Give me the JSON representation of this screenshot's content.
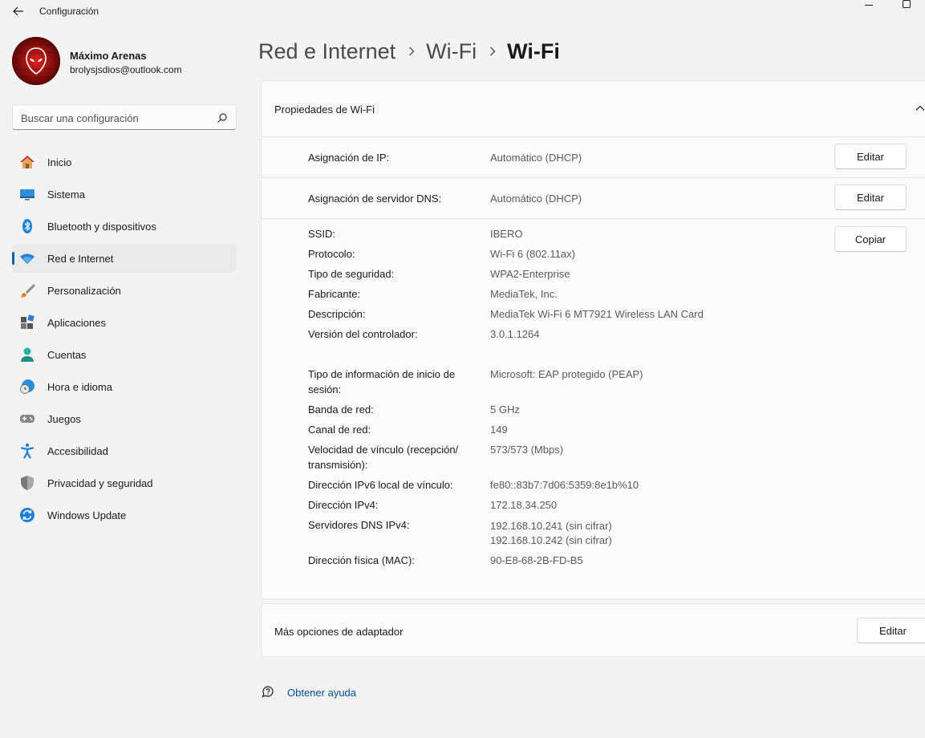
{
  "window": {
    "title": "Configuración"
  },
  "user": {
    "name": "Máximo Arenas",
    "email": "brolysjsdios@outlook.com"
  },
  "search": {
    "placeholder": "Buscar una configuración"
  },
  "sidebar": {
    "items": [
      {
        "label": "Inicio",
        "icon": "home-icon"
      },
      {
        "label": "Sistema",
        "icon": "system-icon"
      },
      {
        "label": "Bluetooth y dispositivos",
        "icon": "bluetooth-icon"
      },
      {
        "label": "Red e Internet",
        "icon": "wifi-icon",
        "selected": true
      },
      {
        "label": "Personalización",
        "icon": "brush-icon"
      },
      {
        "label": "Aplicaciones",
        "icon": "apps-icon"
      },
      {
        "label": "Cuentas",
        "icon": "accounts-icon"
      },
      {
        "label": "Hora e idioma",
        "icon": "time-language-icon"
      },
      {
        "label": "Juegos",
        "icon": "gamepad-icon"
      },
      {
        "label": "Accesibilidad",
        "icon": "accessibility-icon"
      },
      {
        "label": "Privacidad y seguridad",
        "icon": "shield-icon"
      },
      {
        "label": "Windows Update",
        "icon": "update-icon"
      }
    ]
  },
  "breadcrumb": [
    "Red e Internet",
    "Wi-Fi",
    "Wi-Fi"
  ],
  "properties": {
    "header": "Propiedades de Wi-Fi",
    "ip_assignment": {
      "label": "Asignación de IP:",
      "value": "Automático (DHCP)",
      "button": "Editar"
    },
    "dns_assignment": {
      "label": "Asignación de servidor DNS:",
      "value": "Automático (DHCP)",
      "button": "Editar"
    },
    "copy_button": "Copiar",
    "details": [
      {
        "label": "SSID:",
        "value": "IBERO"
      },
      {
        "label": "Protocolo:",
        "value": "Wi-Fi 6 (802.11ax)"
      },
      {
        "label": "Tipo de seguridad:",
        "value": "WPA2-Enterprise"
      },
      {
        "label": "Fabricante:",
        "value": "MediaTek, Inc."
      },
      {
        "label": "Descripción:",
        "value": "MediaTek Wi-Fi 6 MT7921 Wireless LAN Card"
      },
      {
        "label": "Versión del controlador:",
        "value": "3.0.1.1264"
      },
      {
        "label_line1": "Tipo de información de inicio de",
        "label_line2": "sesión:",
        "value": "Microsoft: EAP protegido (PEAP)"
      },
      {
        "label": "Banda de red:",
        "value": "5 GHz"
      },
      {
        "label": "Canal de red:",
        "value": "149"
      },
      {
        "label_line1": "Velocidad de vínculo (recepción/",
        "label_line2": "transmisión):",
        "value": "573/573 (Mbps)"
      },
      {
        "label": "Dirección IPv6 local de vínculo:",
        "value": "fe80::83b7:7d06:5359:8e1b%10"
      },
      {
        "label": "Dirección IPv4:",
        "value": "172.18.34.250"
      },
      {
        "label": "Servidores DNS IPv4:",
        "value_line1": "192.168.10.241 (sin cifrar)",
        "value_line2": "192.168.10.242 (sin cifrar)"
      },
      {
        "label": "Dirección física (MAC):",
        "value": "90-E8-68-2B-FD-B5"
      }
    ]
  },
  "adapter": {
    "label": "Más opciones de adaptador",
    "button": "Editar"
  },
  "help": {
    "link": "Obtener ayuda"
  },
  "colors": {
    "accent": "#005fb8",
    "link": "#004f9f",
    "background": "#f3f3f3",
    "card": "#fbfbfb"
  }
}
